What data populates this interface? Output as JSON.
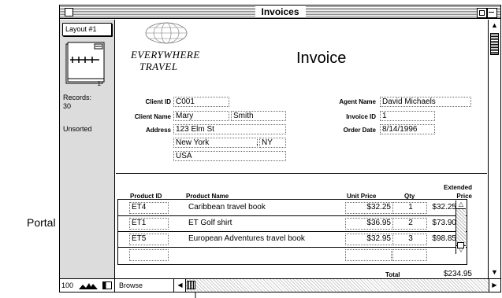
{
  "window": {
    "title": "Invoices"
  },
  "status_area": {
    "layout_label": "Layout #1",
    "book_page": "1",
    "records_label": "Records:",
    "records_count": "30",
    "sort_status": "Unsorted"
  },
  "company": {
    "line1": "EVERYWHERE",
    "line2": "TRAVEL"
  },
  "invoice": {
    "heading": "Invoice",
    "labels": {
      "client_id": "Client ID",
      "client_name": "Client Name",
      "address": "Address",
      "agent_name": "Agent Name",
      "invoice_id": "Invoice ID",
      "order_date": "Order Date"
    },
    "client_id": "C001",
    "first_name": "Mary",
    "last_name": "Smith",
    "street": "123 Elm St",
    "city": "New York",
    "state": "NY",
    "country": "USA",
    "agent_name": "David Michaels",
    "invoice_id": "1",
    "order_date": "8/14/1996"
  },
  "portal": {
    "headers": {
      "product_id": "Product ID",
      "product_name": "Product Name",
      "unit_price": "Unit Price",
      "qty": "Qty",
      "extended_price_line1": "Extended",
      "extended_price_line2": "Price"
    },
    "rows": [
      {
        "product_id": "ET4",
        "product_name": "Caribbean travel book",
        "unit_price": "$32.25",
        "qty": "1",
        "extended": "$32.25"
      },
      {
        "product_id": "ET1",
        "product_name": "ET Golf shirt",
        "unit_price": "$36.95",
        "qty": "2",
        "extended": "$73.90"
      },
      {
        "product_id": "ET5",
        "product_name": "European Adventures travel book",
        "unit_price": "$32.95",
        "qty": "3",
        "extended": "$98.85"
      },
      {
        "product_id": "",
        "product_name": "",
        "unit_price": "",
        "qty": "",
        "extended": ""
      }
    ],
    "total_label": "Total",
    "total_value": "$234.95"
  },
  "bottom_bar": {
    "zoom_level": "100",
    "mode": "Browse"
  },
  "callouts": {
    "portal": "Portal"
  }
}
